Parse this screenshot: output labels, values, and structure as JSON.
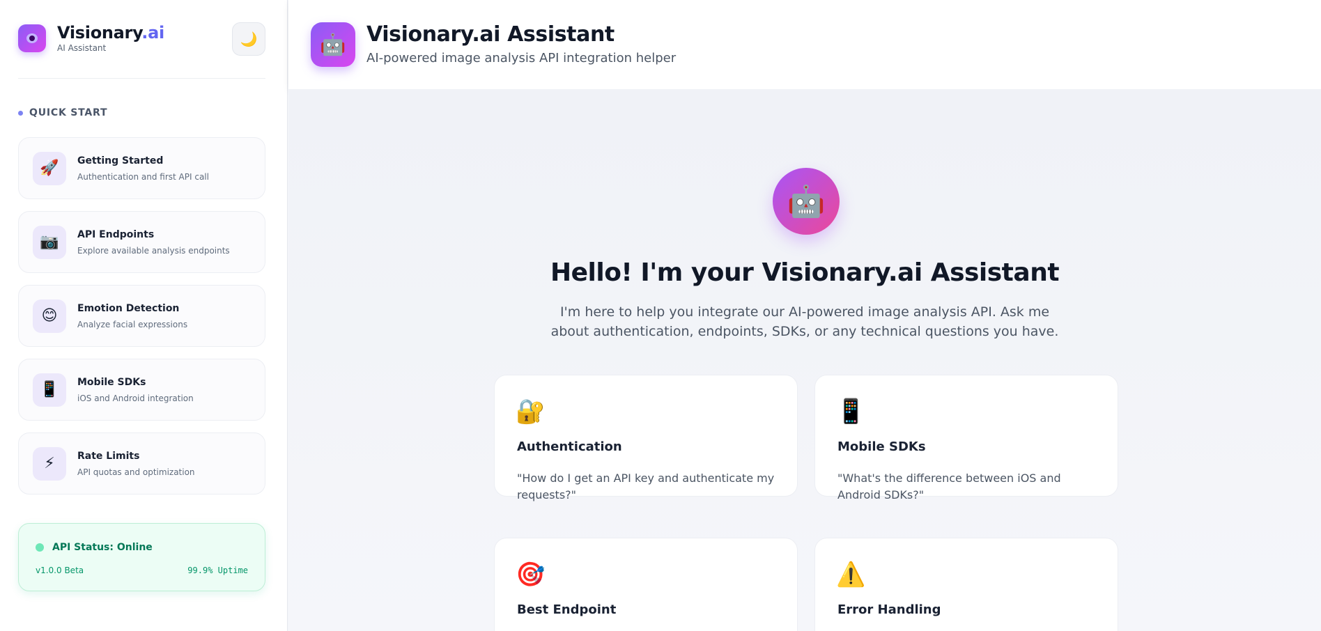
{
  "sidebar": {
    "brand": {
      "name": "Visionary",
      "name_accent": ".ai",
      "subtitle": "AI Assistant"
    },
    "theme_toggle_icon": "🌙",
    "section_title": "QUICK START",
    "items": [
      {
        "icon": "🚀",
        "title": "Getting Started",
        "desc": "Authentication and first API call"
      },
      {
        "icon": "📷",
        "title": "API Endpoints",
        "desc": "Explore available analysis endpoints"
      },
      {
        "icon": "😊",
        "title": "Emotion Detection",
        "desc": "Analyze facial expressions"
      },
      {
        "icon": "📱",
        "title": "Mobile SDKs",
        "desc": "iOS and Android integration"
      },
      {
        "icon": "⚡",
        "title": "Rate Limits",
        "desc": "API quotas and optimization"
      }
    ],
    "status": {
      "label": "API Status: Online",
      "version": "v1.0.0 Beta",
      "uptime": "99.9% Uptime"
    }
  },
  "header": {
    "icon": "🤖",
    "title": "Visionary.ai Assistant",
    "subtitle": "AI-powered image analysis API integration helper"
  },
  "main": {
    "avatar_icon": "🤖",
    "title": "Hello! I'm your Visionary.ai Assistant",
    "description": "I'm here to help you integrate our AI-powered image analysis API. Ask me about authentication, endpoints, SDKs, or any technical questions you have.",
    "cards": [
      {
        "icon": "🔐",
        "title": "Authentication",
        "desc": "\"How do I get an API key and authenticate my requests?\""
      },
      {
        "icon": "📱",
        "title": "Mobile SDKs",
        "desc": "\"What's the difference between iOS and Android SDKs?\""
      },
      {
        "icon": "🎯",
        "title": "Best Endpoint",
        "desc": ""
      },
      {
        "icon": "⚠️",
        "title": "Error Handling",
        "desc": ""
      }
    ]
  },
  "colors": {
    "accent": "#6366f1",
    "brand_gradient_start": "#8b5cf6",
    "brand_gradient_end": "#d946ef",
    "status_online": "#047857"
  }
}
